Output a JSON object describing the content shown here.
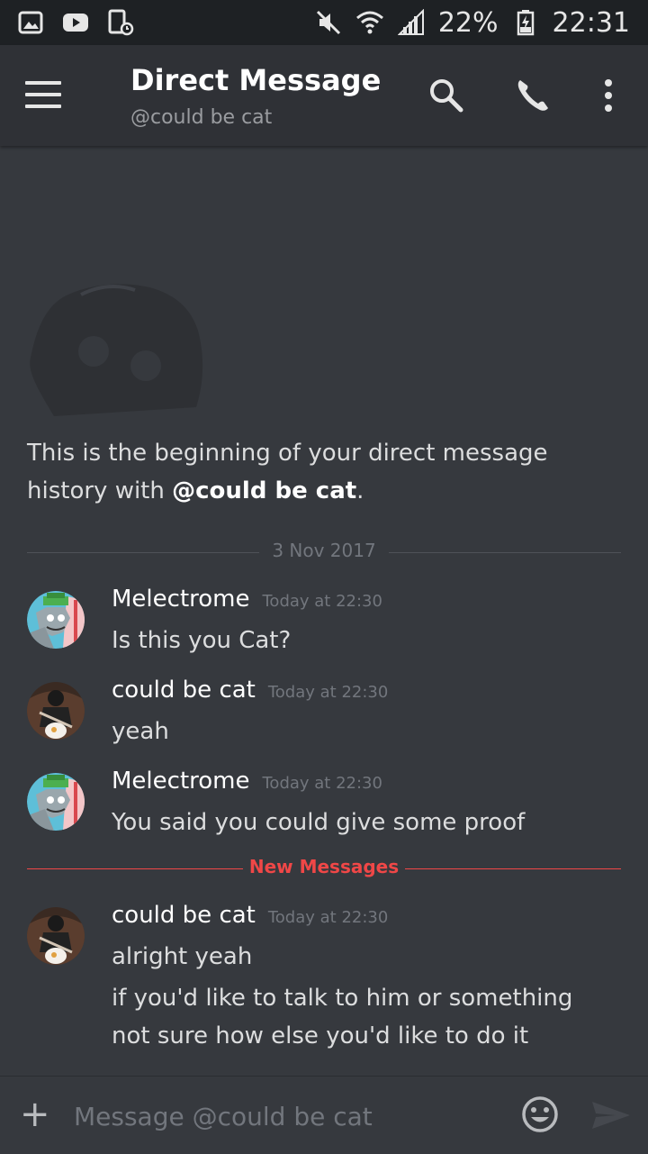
{
  "status_bar": {
    "battery": "22%",
    "time": "22:31",
    "left_icons": [
      "gallery-icon",
      "youtube-icon",
      "device-icon"
    ],
    "right_icons": [
      "mute-icon",
      "wifi-icon",
      "signal-icon",
      "battery-charging-icon"
    ]
  },
  "header": {
    "title": "Direct Message",
    "subtitle": "@could be cat",
    "icons": [
      "menu-icon",
      "search-icon",
      "phone-icon",
      "more-icon"
    ]
  },
  "intro": {
    "text": "This is the beginning of your direct message history with ",
    "username": "@could be cat",
    "period": "."
  },
  "date_divider": "3 Nov 2017",
  "new_messages_label": "New Messages",
  "messages": [
    {
      "author": "Melectrome",
      "timestamp": "Today at 22:30",
      "lines": [
        "Is this you Cat?"
      ]
    },
    {
      "author": "could be cat",
      "timestamp": "Today at 22:30",
      "lines": [
        "yeah"
      ]
    },
    {
      "author": "Melectrome",
      "timestamp": "Today at 22:30",
      "lines": [
        "You said you could give some proof"
      ]
    },
    {
      "author": "could be cat",
      "timestamp": "Today at 22:30",
      "lines": [
        "alright yeah",
        "if you'd like to talk to him or something",
        "not sure how else you'd like to do it"
      ]
    }
  ],
  "input": {
    "placeholder": "Message @could be cat",
    "plus": "+"
  },
  "colors": {
    "background": "#36393e",
    "header": "#2f3136",
    "statusbar": "#1e2124",
    "new_messages": "#f04747"
  }
}
